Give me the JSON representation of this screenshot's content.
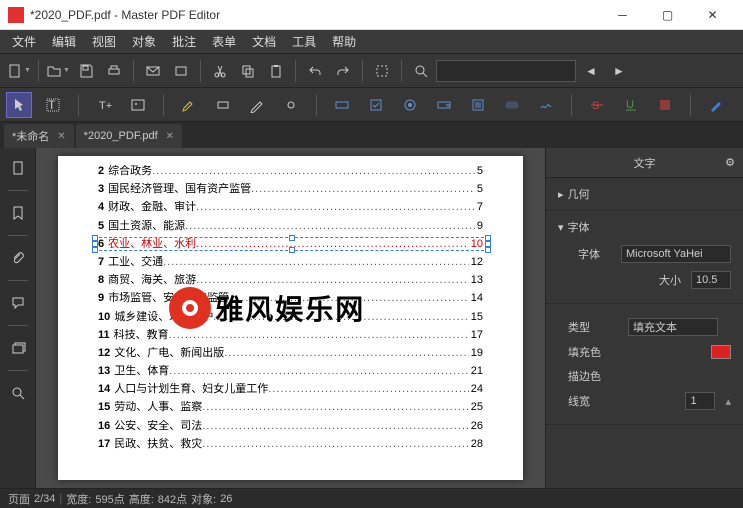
{
  "window": {
    "title": "*2020_PDF.pdf - Master PDF Editor"
  },
  "menu": [
    "文件",
    "编辑",
    "视图",
    "对象",
    "批注",
    "表单",
    "文档",
    "工具",
    "帮助"
  ],
  "tabs": [
    {
      "label": "*未命名"
    },
    {
      "label": "*2020_PDF.pdf"
    }
  ],
  "search": {
    "placeholder": ""
  },
  "toc": [
    {
      "n": "2",
      "t": "综合政务",
      "p": "5",
      "sel": false
    },
    {
      "n": "3",
      "t": "国民经济管理、国有资产监管",
      "p": "5",
      "sel": false
    },
    {
      "n": "4",
      "t": "财政、金融、审计",
      "p": "7",
      "sel": false
    },
    {
      "n": "5",
      "t": "国土资源、能源",
      "p": "9",
      "sel": false
    },
    {
      "n": "6",
      "t": "农业、林业、水利",
      "p": "10",
      "sel": true
    },
    {
      "n": "7",
      "t": "工业、交通",
      "p": "12",
      "sel": false
    },
    {
      "n": "8",
      "t": "商贸、海关、旅游",
      "p": "13",
      "sel": false
    },
    {
      "n": "9",
      "t": "市场监管、安全生产监管",
      "p": "14",
      "sel": false
    },
    {
      "n": "10",
      "t": "城乡建设、环境保护",
      "p": "15",
      "sel": false
    },
    {
      "n": "11",
      "t": "科技、教育",
      "p": "17",
      "sel": false
    },
    {
      "n": "12",
      "t": "文化、广电、新闻出版",
      "p": "19",
      "sel": false
    },
    {
      "n": "13",
      "t": "卫生、体育",
      "p": "21",
      "sel": false
    },
    {
      "n": "14",
      "t": "人口与计划生育、妇女儿童工作",
      "p": "24",
      "sel": false
    },
    {
      "n": "15",
      "t": "劳动、人事、监察",
      "p": "25",
      "sel": false
    },
    {
      "n": "16",
      "t": "公安、安全、司法",
      "p": "26",
      "sel": false
    },
    {
      "n": "17",
      "t": "民政、扶贫、救灾",
      "p": "28",
      "sel": false
    }
  ],
  "watermark": "雅风娱乐网",
  "props": {
    "panel_title": "文字",
    "section_geom": "几何",
    "section_font": "字体",
    "font_label": "字体",
    "font_value": "Microsoft YaHei",
    "size_label": "大小",
    "size_value": "10.5",
    "type_label": "类型",
    "type_value": "填充文本",
    "fill_label": "填充色",
    "fill_color": "#e02020",
    "stroke_label": "描边色",
    "width_label": "线宽",
    "width_value": "1"
  },
  "status": {
    "page_label": "页面",
    "page_value": "2/34",
    "w_label": "宽度:",
    "w_value": "595点",
    "h_label": "高度:",
    "h_value": "842点",
    "obj_label": "对象:",
    "obj_value": "26"
  }
}
